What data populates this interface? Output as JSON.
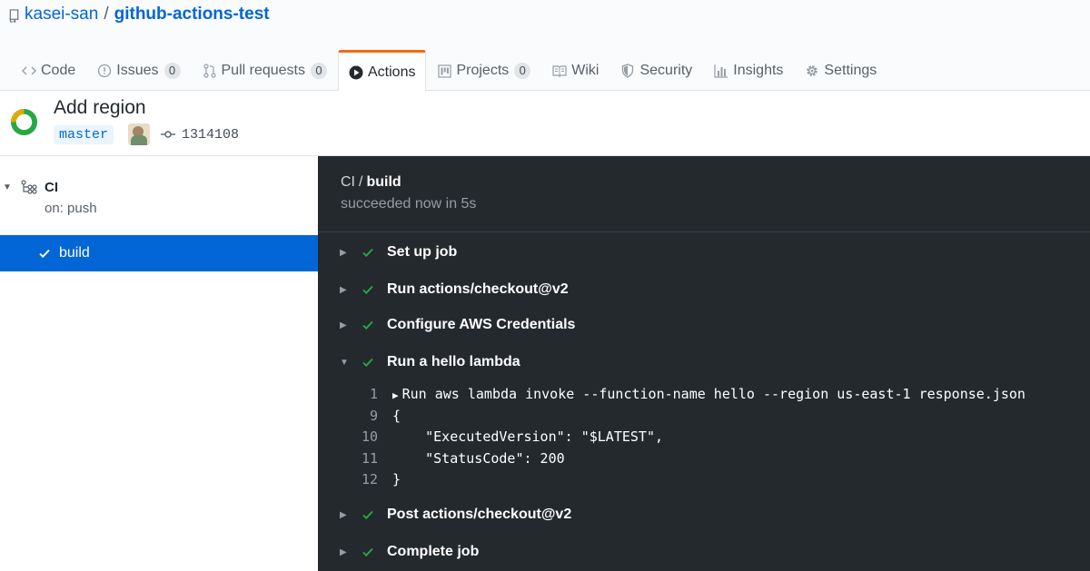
{
  "repo": {
    "owner": "kasei-san",
    "separator": "/",
    "name": "github-actions-test"
  },
  "tabs": [
    {
      "label": "Code",
      "icon": "code-icon",
      "count": null
    },
    {
      "label": "Issues",
      "icon": "issue-icon",
      "count": "0"
    },
    {
      "label": "Pull requests",
      "icon": "pull-request-icon",
      "count": "0"
    },
    {
      "label": "Actions",
      "icon": "play-icon",
      "count": null,
      "selected": true
    },
    {
      "label": "Projects",
      "icon": "project-icon",
      "count": "0"
    },
    {
      "label": "Wiki",
      "icon": "book-icon",
      "count": null
    },
    {
      "label": "Security",
      "icon": "shield-icon",
      "count": null
    },
    {
      "label": "Insights",
      "icon": "graph-icon",
      "count": null
    },
    {
      "label": "Settings",
      "icon": "gear-icon",
      "count": null
    }
  ],
  "run": {
    "title": "Add region",
    "branch": "master",
    "commit": "1314108"
  },
  "sidebar": {
    "workflow": {
      "name": "CI",
      "trigger": "on: push"
    },
    "job": {
      "label": "build"
    }
  },
  "log": {
    "workflow": "CI",
    "separator": "/",
    "job": "build",
    "status": "succeeded now in 5s",
    "steps": [
      {
        "name": "Set up job",
        "expanded": false
      },
      {
        "name": "Run actions/checkout@v2",
        "expanded": false
      },
      {
        "name": "Configure AWS Credentials",
        "expanded": false
      },
      {
        "name": "Run a hello lambda",
        "expanded": true
      },
      {
        "name": "Post actions/checkout@v2",
        "expanded": false
      },
      {
        "name": "Complete job",
        "expanded": false
      }
    ],
    "lines": [
      {
        "num": "1",
        "text": "Run aws lambda invoke --function-name hello --region us-east-1 response.json",
        "collapsible": true
      },
      {
        "num": "9",
        "text": "{"
      },
      {
        "num": "10",
        "text": "    \"ExecutedVersion\": \"$LATEST\","
      },
      {
        "num": "11",
        "text": "    \"StatusCode\": 200"
      },
      {
        "num": "12",
        "text": "}"
      }
    ]
  },
  "colors": {
    "link": "#0366d6",
    "selected_tab_border": "#f66a0a",
    "success": "#28a745",
    "log_bg": "#24292e",
    "status_ring_yellow": "#dbab09",
    "status_ring_green": "#28a745"
  }
}
